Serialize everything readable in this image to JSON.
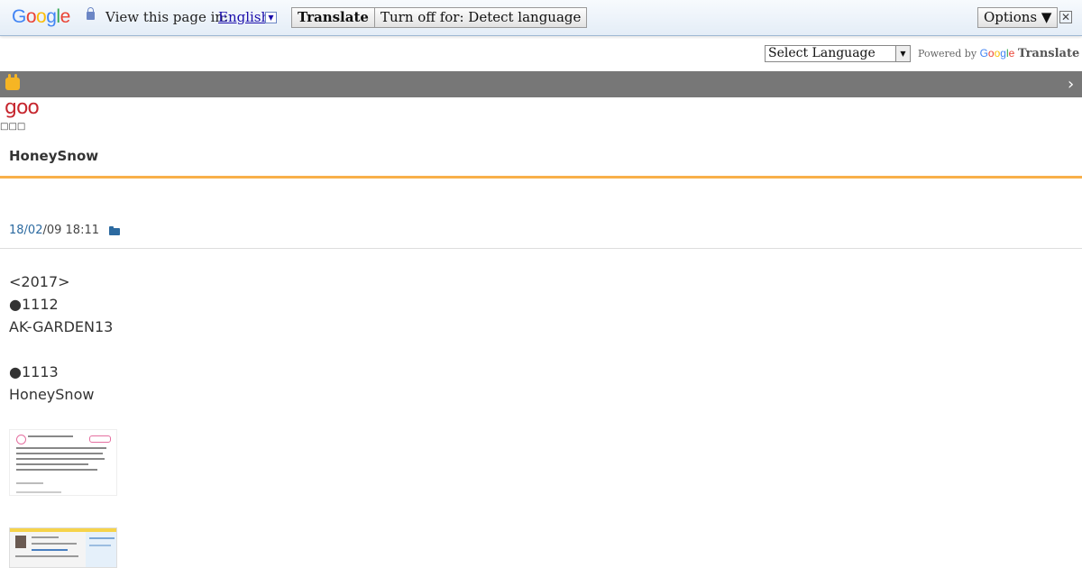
{
  "translate_bar": {
    "logo": [
      "G",
      "o",
      "o",
      "g",
      "l",
      "e"
    ],
    "view_label": "View this page in:",
    "language": "English",
    "translate_button": "Translate",
    "turn_off_button": "Turn off for: Detect language",
    "options_button": "Options ▼",
    "close": "✕"
  },
  "language_select": {
    "value": "Select Language",
    "powered_by": "Powered by",
    "google_word": [
      "G",
      "o",
      "o",
      "g",
      "l",
      "e"
    ],
    "translate_word": "Translate"
  },
  "nav": {
    "next_glyph": "›"
  },
  "site": {
    "logo": "goo",
    "tofu": "□□□"
  },
  "blog": {
    "title": "HoneySnow"
  },
  "post": {
    "date_link": "18/02",
    "date_rest": "/09 18:11",
    "lines": [
      "<2017>",
      "●1112",
      "AK-GARDEN13",
      "",
      "●1113",
      "HoneySnow"
    ]
  },
  "colors": {
    "accent_orange": "#f8b04a",
    "nav_grey": "#777777",
    "goo_red": "#c6262e",
    "link_blue": "#2c6aa0"
  }
}
